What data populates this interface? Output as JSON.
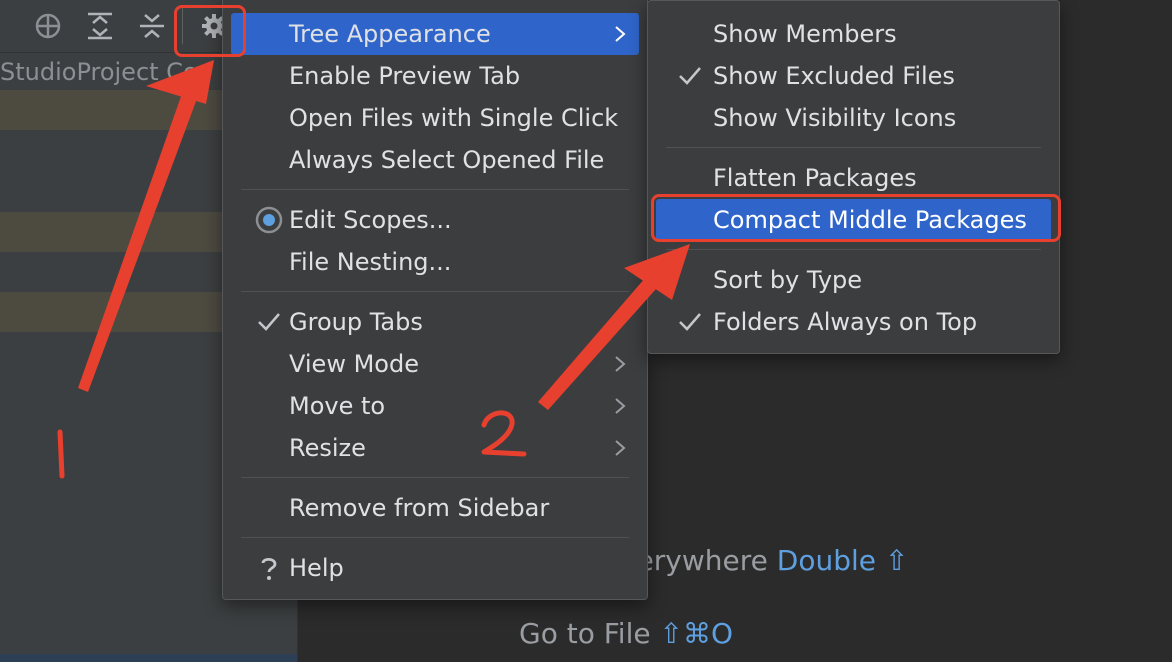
{
  "left_panel": {
    "path_text": "StudioProject  Cor"
  },
  "main_menu": {
    "items": [
      {
        "label": "Tree Appearance"
      },
      {
        "label": "Enable Preview Tab"
      },
      {
        "label": "Open Files with Single Click"
      },
      {
        "label": "Always Select Opened File"
      },
      {
        "label": "Edit Scopes..."
      },
      {
        "label": "File Nesting..."
      },
      {
        "label": "Group Tabs"
      },
      {
        "label": "View Mode"
      },
      {
        "label": "Move to"
      },
      {
        "label": "Resize"
      },
      {
        "label": "Remove from Sidebar"
      },
      {
        "label": "Help"
      }
    ]
  },
  "sub_menu": {
    "items": [
      {
        "label": "Show Members"
      },
      {
        "label": "Show Excluded Files"
      },
      {
        "label": "Show Visibility Icons"
      },
      {
        "label": "Flatten Packages"
      },
      {
        "label": "Compact Middle Packages"
      },
      {
        "label": "Sort by Type"
      },
      {
        "label": "Folders Always on Top"
      }
    ]
  },
  "editor_hints": {
    "search_label": "verywhere",
    "search_shortcut": "Double ⇧",
    "goto_label": "Go to File",
    "goto_shortcut": "⇧⌘O"
  },
  "annotations": {
    "step1": "1",
    "step2": "2"
  },
  "colors": {
    "selection": "#2f65ca",
    "annotation": "#e8402f",
    "shortcut": "#5e9fe0"
  }
}
